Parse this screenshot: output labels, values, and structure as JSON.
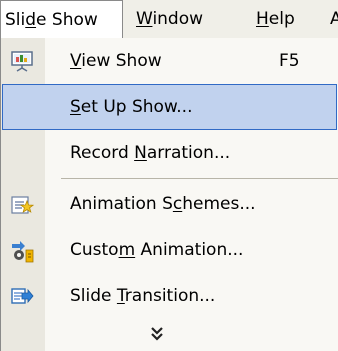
{
  "menubar": {
    "slide_show": {
      "pre": "Sli",
      "key": "d",
      "post": "e Show"
    },
    "window": {
      "pre": "",
      "key": "W",
      "post": "indow"
    },
    "help": {
      "pre": "",
      "key": "H",
      "post": "elp"
    },
    "extra": "A"
  },
  "menu": {
    "view_show": {
      "pre": "",
      "key": "V",
      "post": "iew Show",
      "shortcut": "F5",
      "icon": "projection-screen-icon"
    },
    "set_up_show": {
      "pre": "",
      "key": "S",
      "post": "et Up Show..."
    },
    "record_narration": {
      "pre": "Record ",
      "key": "N",
      "post": "arration..."
    },
    "animation_schemes": {
      "pre": "Animation S",
      "key": "c",
      "post": "hemes...",
      "icon": "star-lines-icon"
    },
    "custom_animation": {
      "pre": "Custo",
      "key": "m",
      "post": " Animation...",
      "icon": "custom-animation-icon"
    },
    "slide_transition": {
      "pre": "Slide ",
      "key": "T",
      "post": "ransition...",
      "icon": "slide-transition-icon"
    },
    "expand_icon": "double-chevron-down-icon"
  },
  "colors": {
    "highlight_fill": "#c1d2ee",
    "highlight_border": "#316ac5",
    "menubar_bg": "#f0efe8",
    "gutter_bg": "#eae8e0"
  }
}
